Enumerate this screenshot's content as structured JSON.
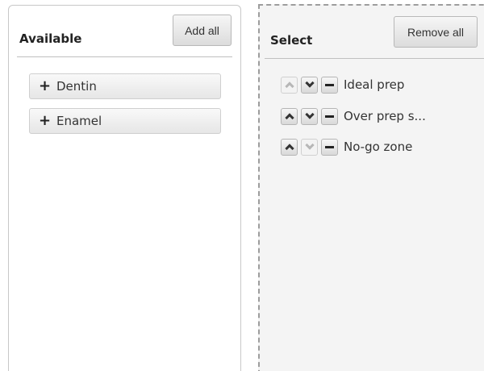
{
  "available": {
    "title": "Available",
    "add_all_label": "Add all",
    "items": [
      {
        "label": "Dentin",
        "icon": "plus-icon"
      },
      {
        "label": "Enamel",
        "icon": "plus-icon"
      }
    ]
  },
  "select": {
    "title": "Select",
    "remove_all_label": "Remove all",
    "items": [
      {
        "label": "Ideal prep",
        "up_enabled": false,
        "down_enabled": true
      },
      {
        "label": "Over prep s...",
        "up_enabled": true,
        "down_enabled": true
      },
      {
        "label": "No-go zone",
        "up_enabled": true,
        "down_enabled": false
      }
    ]
  }
}
